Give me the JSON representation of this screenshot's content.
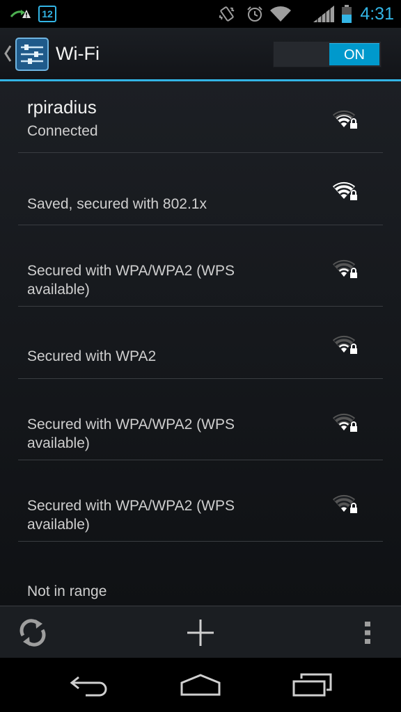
{
  "status_bar": {
    "time": "4:31",
    "calendar_day": "12",
    "icons": [
      "sync-arrow-icon",
      "warning-icon",
      "calendar-icon",
      "vibrate-icon",
      "alarm-icon",
      "wifi-icon",
      "cell-signal-icon",
      "battery-icon"
    ],
    "accent": "#33b5e5"
  },
  "action_bar": {
    "title": "Wi-Fi",
    "toggle_label": "ON",
    "toggle_state": "on"
  },
  "networks": [
    {
      "ssid": "rpiradius",
      "summary": "Connected",
      "signal": 3,
      "secured": true
    },
    {
      "ssid": "",
      "summary": "Saved, secured with 802.1x",
      "signal": 4,
      "secured": true
    },
    {
      "ssid": "",
      "summary": "Secured with WPA/WPA2 (WPS available)",
      "signal": 2,
      "secured": true
    },
    {
      "ssid": "",
      "summary": "Secured with WPA2",
      "signal": 2,
      "secured": true
    },
    {
      "ssid": "",
      "summary": "Secured with WPA/WPA2 (WPS available)",
      "signal": 2,
      "secured": true
    },
    {
      "ssid": "",
      "summary": "Secured with WPA/WPA2 (WPS available)",
      "signal": 1,
      "secured": true
    },
    {
      "ssid": "",
      "summary": "Not in range",
      "signal": 0,
      "secured": false
    }
  ],
  "bottom_bar": {
    "buttons": [
      "scan-icon",
      "add-network-icon",
      "overflow-menu-icon"
    ]
  },
  "nav_bar": {
    "buttons": [
      "back-icon",
      "home-icon",
      "recents-icon"
    ]
  },
  "colors": {
    "accent": "#33b5e5",
    "toggle_on": "#0099cc"
  }
}
